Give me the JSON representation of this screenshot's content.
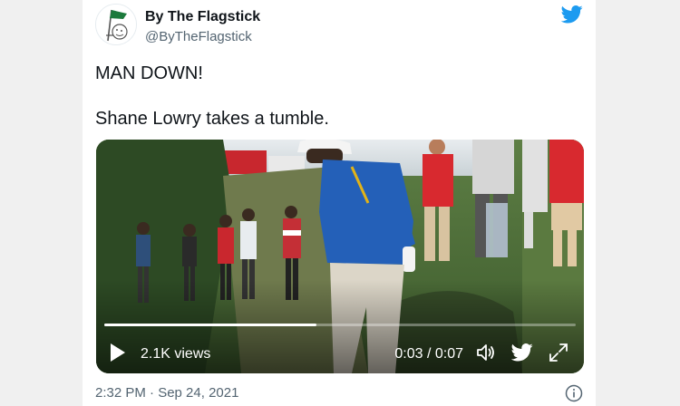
{
  "tweet": {
    "display_name": "By The Flagstick",
    "handle": "@ByTheFlagstick",
    "text_line1": "MAN DOWN!",
    "text_line2": "Shane Lowry takes a tumble.",
    "timestamp": "2:32 PM · Sep 24, 2021"
  },
  "video": {
    "views": "2.1K views",
    "time": "0:03 / 0:07",
    "progress": 0.45
  },
  "colors": {
    "twitter_blue": "#1d9bf0",
    "avatar_green": "#1c7a3c"
  },
  "icons": {
    "brand": "twitter-bird-icon",
    "play": "play-icon",
    "volume": "volume-icon",
    "share": "twitter-bird-icon",
    "fullscreen": "fullscreen-icon",
    "info": "info-icon"
  }
}
